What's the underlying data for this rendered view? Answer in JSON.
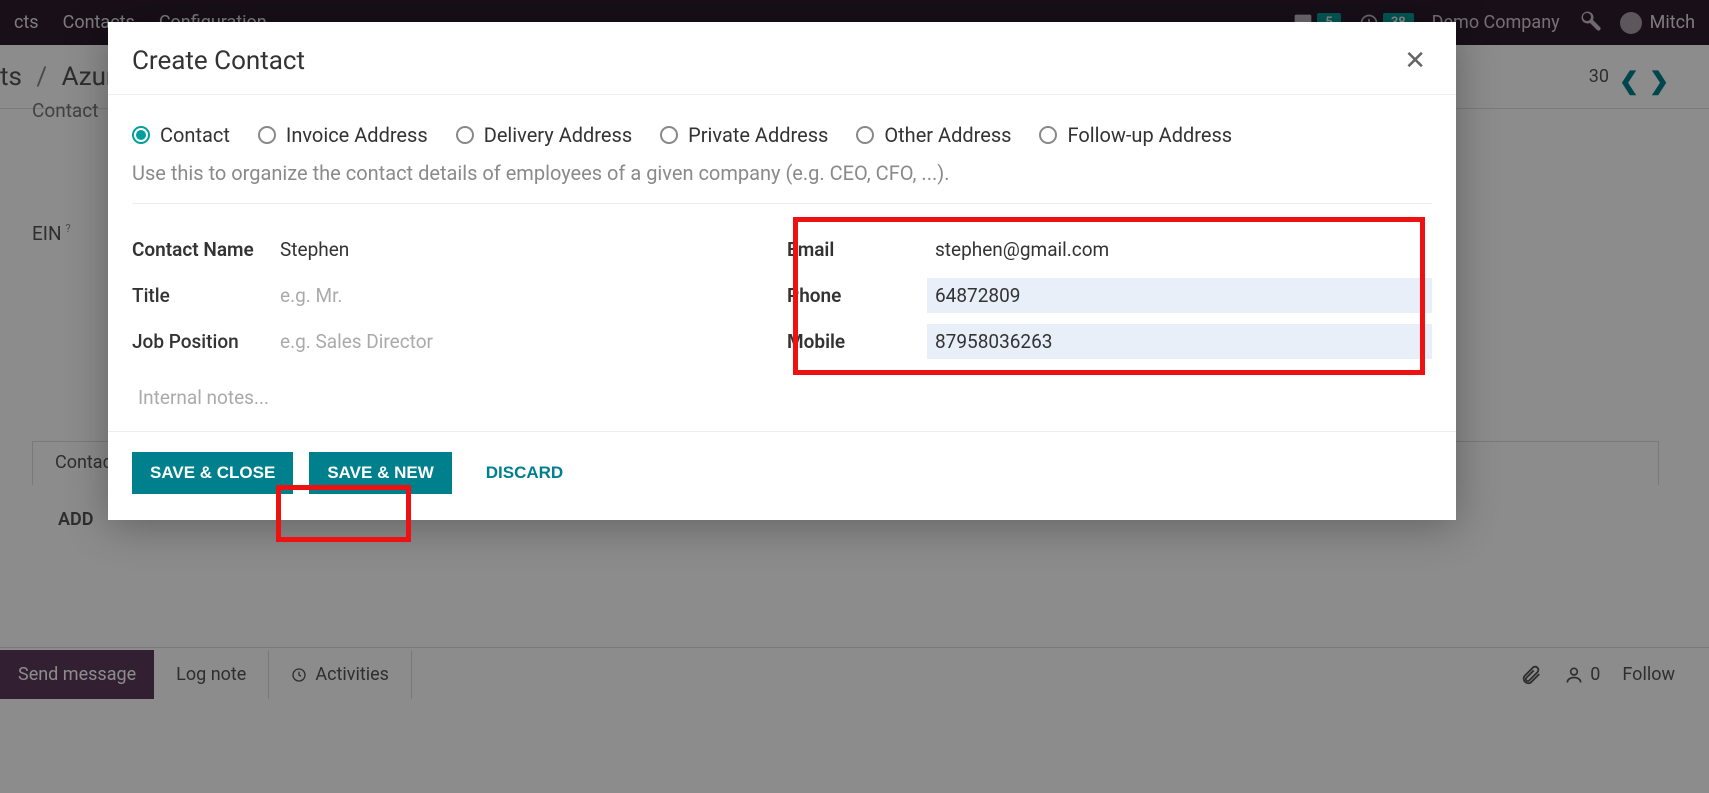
{
  "topbar": {
    "menu_app": "cts",
    "menu_contacts": "Contacts",
    "menu_config": "Configuration",
    "msg_count": "5",
    "clock_count": "38",
    "company": "Demo Company",
    "user": "Mitch"
  },
  "breadcrumb": {
    "root": "ts",
    "current": "Azure",
    "page_total": "30"
  },
  "underlay": {
    "contact_label": "Contact",
    "ein_label": "EIN",
    "tab_contact": "Contact",
    "add_label": "ADD"
  },
  "modal": {
    "title": "Create Contact",
    "radios": {
      "contact": "Contact",
      "invoice": "Invoice Address",
      "delivery": "Delivery Address",
      "private": "Private Address",
      "other": "Other Address",
      "followup": "Follow-up Address"
    },
    "help": "Use this to organize the contact details of employees of a given company (e.g. CEO, CFO, ...).",
    "left": {
      "contact_name_label": "Contact Name",
      "contact_name_value": "Stephen",
      "title_label": "Title",
      "title_placeholder": "e.g. Mr.",
      "job_label": "Job Position",
      "job_placeholder": "e.g. Sales Director"
    },
    "right": {
      "email_label": "Email",
      "email_value": "stephen@gmail.com",
      "phone_label": "Phone",
      "phone_value": "64872809",
      "mobile_label": "Mobile",
      "mobile_value": "87958036263"
    },
    "notes_placeholder": "Internal notes...",
    "footer": {
      "save_close": "SAVE & CLOSE",
      "save_new": "SAVE & NEW",
      "discard": "DISCARD"
    }
  },
  "chatbar": {
    "send": "Send message",
    "lognote": "Log note",
    "activities": "Activities",
    "follower_count": "0",
    "follow": "Follow"
  }
}
